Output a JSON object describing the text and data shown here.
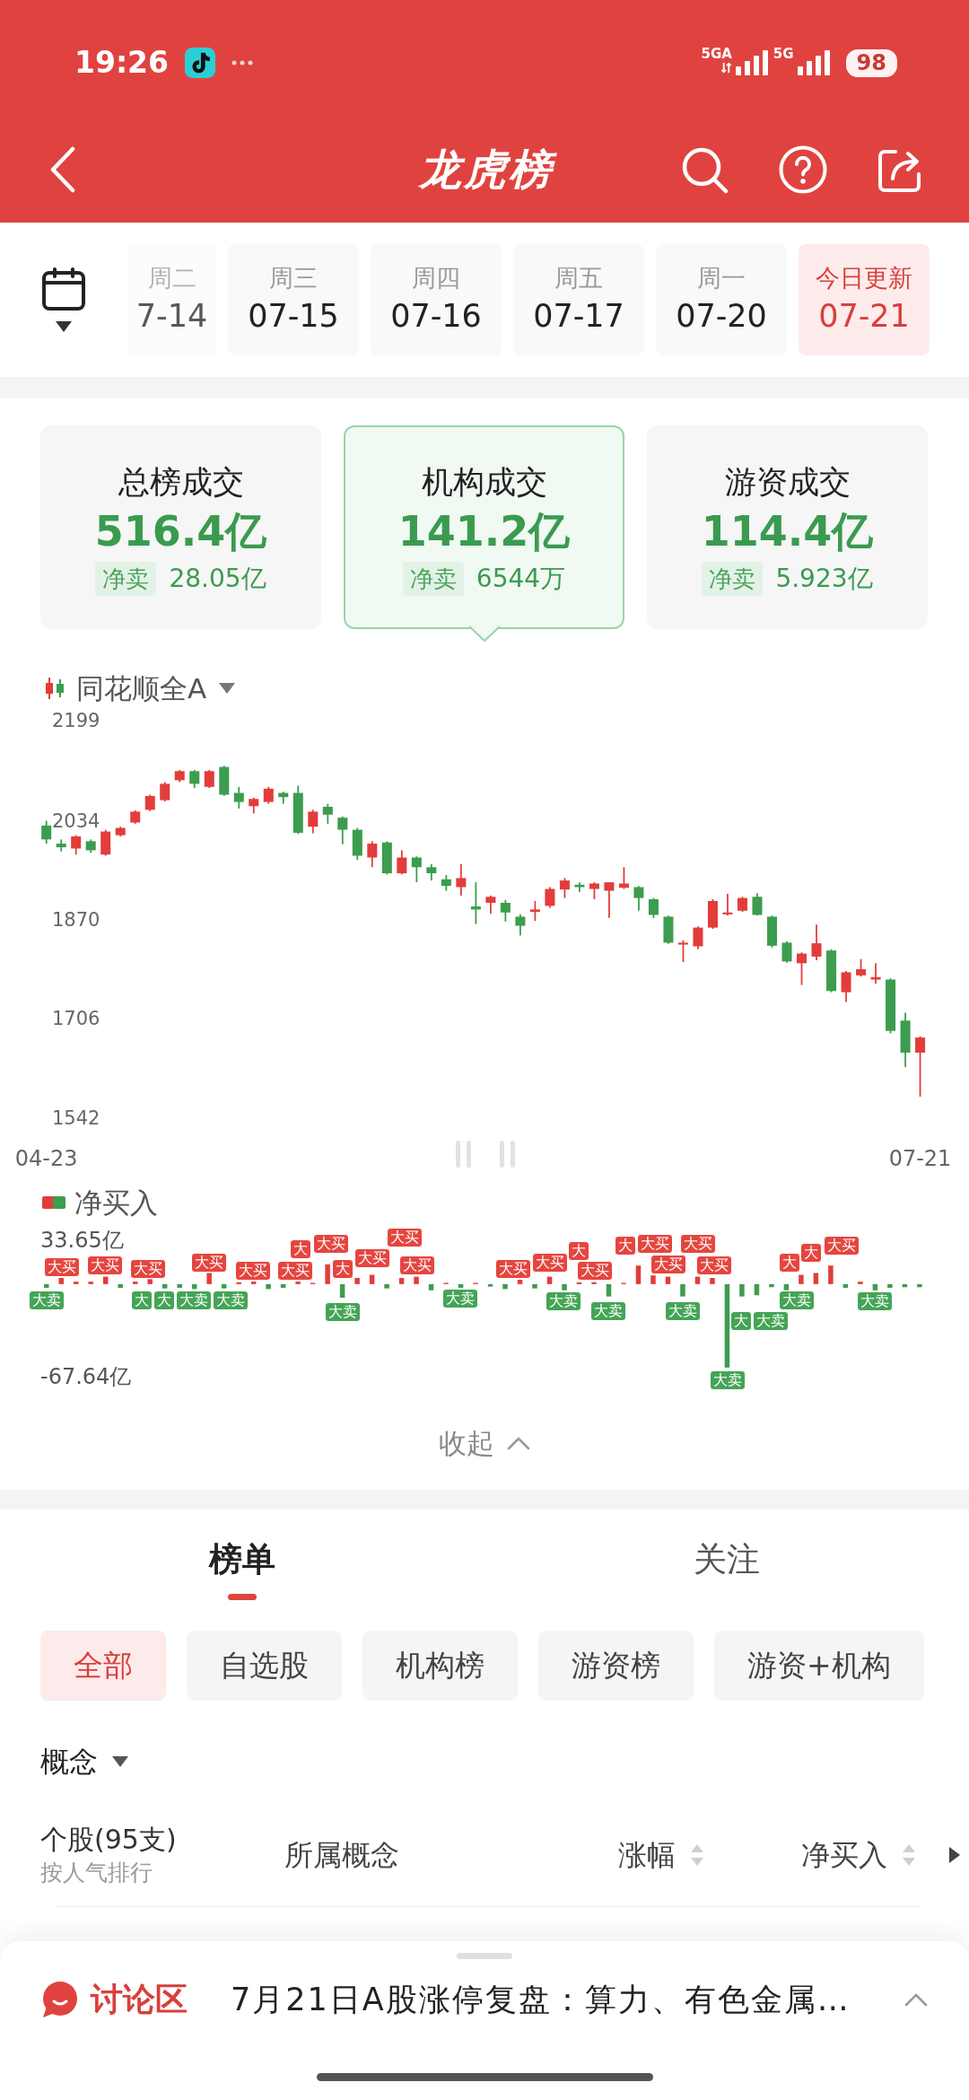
{
  "status_bar": {
    "time": "19:26",
    "networks": [
      {
        "label": "5GA",
        "activity": true
      },
      {
        "label": "5G",
        "activity": false
      }
    ],
    "battery": "98"
  },
  "header": {
    "title": "龙虎榜"
  },
  "date_tabs": [
    {
      "weekday": "周二",
      "date": "7-14",
      "selected": false
    },
    {
      "weekday": "周三",
      "date": "07-15",
      "selected": false
    },
    {
      "weekday": "周四",
      "date": "07-16",
      "selected": false
    },
    {
      "weekday": "周五",
      "date": "07-17",
      "selected": false
    },
    {
      "weekday": "周一",
      "date": "07-20",
      "selected": false
    },
    {
      "weekday": "今日更新",
      "date": "07-21",
      "selected": true
    }
  ],
  "summary_cards": [
    {
      "title": "总榜成交",
      "amount": "516.4亿",
      "tag": "净卖",
      "net": "28.05亿",
      "selected": false
    },
    {
      "title": "机构成交",
      "amount": "141.2亿",
      "tag": "净卖",
      "net": "6544万",
      "selected": true
    },
    {
      "title": "游资成交",
      "amount": "114.4亿",
      "tag": "净卖",
      "net": "5.923亿",
      "selected": false
    }
  ],
  "index_chart": {
    "index_name": "同花顺全A",
    "chart_data": {
      "type": "candlestick",
      "categories": [
        "04-23",
        null,
        null,
        null,
        null,
        null,
        null,
        null,
        null,
        null,
        null,
        null,
        null,
        null,
        null,
        null,
        null,
        null,
        null,
        null,
        null,
        null,
        null,
        null,
        null,
        null,
        null,
        null,
        null,
        null,
        null,
        null,
        null,
        null,
        null,
        null,
        null,
        null,
        null,
        null,
        null,
        null,
        null,
        null,
        null,
        null,
        null,
        null,
        null,
        null,
        null,
        null,
        null,
        null,
        null,
        null,
        null,
        null,
        null,
        "07-21"
      ],
      "ohlc": [
        [
          2026,
          2034,
          1996,
          2003
        ],
        [
          1996,
          2003,
          1983,
          1990
        ],
        [
          1988,
          2010,
          1978,
          2008
        ],
        [
          2000,
          2003,
          1981,
          1985
        ],
        [
          1978,
          2019,
          1976,
          2016
        ],
        [
          2010,
          2024,
          2008,
          2022
        ],
        [
          2031,
          2051,
          2029,
          2049
        ],
        [
          2052,
          2077,
          2050,
          2075
        ],
        [
          2068,
          2098,
          2066,
          2095
        ],
        [
          2101,
          2118,
          2098,
          2116
        ],
        [
          2116,
          2118,
          2088,
          2095
        ],
        [
          2090,
          2118,
          2088,
          2116
        ],
        [
          2123,
          2125,
          2075,
          2077
        ],
        [
          2080,
          2090,
          2054,
          2065
        ],
        [
          2058,
          2072,
          2046,
          2070
        ],
        [
          2065,
          2090,
          2062,
          2087
        ],
        [
          2080,
          2082,
          2062,
          2073
        ],
        [
          2080,
          2092,
          2012,
          2014
        ],
        [
          2024,
          2052,
          2013,
          2049
        ],
        [
          2057,
          2062,
          2029,
          2044
        ],
        [
          2039,
          2041,
          1995,
          2019
        ],
        [
          2019,
          2022,
          1969,
          1976
        ],
        [
          1973,
          2000,
          1957,
          1996
        ],
        [
          1998,
          2000,
          1945,
          1947
        ],
        [
          1947,
          1985,
          1945,
          1973
        ],
        [
          1973,
          1975,
          1932,
          1957
        ],
        [
          1957,
          1962,
          1935,
          1947
        ],
        [
          1937,
          1944,
          1918,
          1926
        ],
        [
          1924,
          1962,
          1910,
          1939
        ],
        [
          1892,
          1932,
          1863,
          1887
        ],
        [
          1898,
          1910,
          1880,
          1908
        ],
        [
          1898,
          1903,
          1867,
          1882
        ],
        [
          1875,
          1879,
          1844,
          1860
        ],
        [
          1883,
          1901,
          1868,
          1887
        ],
        [
          1893,
          1924,
          1890,
          1921
        ],
        [
          1920,
          1939,
          1906,
          1935
        ],
        [
          1928,
          1932,
          1916,
          1924
        ],
        [
          1921,
          1932,
          1904,
          1930
        ],
        [
          1918,
          1932,
          1873,
          1932
        ],
        [
          1923,
          1957,
          1921,
          1930
        ],
        [
          1924,
          1926,
          1885,
          1906
        ],
        [
          1904,
          1906,
          1873,
          1878
        ],
        [
          1875,
          1877,
          1830,
          1832
        ],
        [
          1829,
          1836,
          1800,
          1832
        ],
        [
          1826,
          1859,
          1821,
          1857
        ],
        [
          1857,
          1904,
          1855,
          1901
        ],
        [
          1879,
          1913,
          1877,
          1882
        ],
        [
          1885,
          1908,
          1883,
          1906
        ],
        [
          1908,
          1914,
          1877,
          1878
        ],
        [
          1875,
          1877,
          1824,
          1827
        ],
        [
          1832,
          1834,
          1799,
          1801
        ],
        [
          1798,
          1816,
          1762,
          1814
        ],
        [
          1809,
          1862,
          1803,
          1831
        ],
        [
          1819,
          1821,
          1750,
          1752
        ],
        [
          1750,
          1785,
          1734,
          1783
        ],
        [
          1778,
          1805,
          1776,
          1788
        ],
        [
          1771,
          1798,
          1764,
          1775
        ],
        [
          1771,
          1773,
          1682,
          1686
        ],
        [
          1703,
          1716,
          1626,
          1650
        ],
        [
          1650,
          1677,
          1577,
          1675
        ]
      ],
      "ylim": [
        1542,
        2199
      ],
      "yticks": [
        2199,
        2034,
        1870,
        1706,
        1542
      ]
    }
  },
  "net_buy_chart": {
    "legend": "净买入",
    "y_labels": [
      "33.65亿",
      "-67.64亿"
    ],
    "markers": [
      {
        "label": "大卖",
        "kind": "sell"
      },
      {
        "label": "大买",
        "kind": "buy"
      },
      {
        "label": "大买",
        "kind": "buy"
      },
      {
        "label": "大",
        "kind": "sell"
      },
      {
        "label": "大买",
        "kind": "buy"
      },
      {
        "label": "大",
        "kind": "sell"
      },
      {
        "label": "大卖",
        "kind": "sell"
      },
      {
        "label": "大买",
        "kind": "buy"
      },
      {
        "label": "大卖",
        "kind": "sell"
      },
      {
        "label": "大买",
        "kind": "buy"
      },
      {
        "label": "大买",
        "kind": "buy"
      },
      {
        "label": "大",
        "kind": "buy"
      },
      {
        "label": "大买",
        "kind": "buy"
      },
      {
        "label": "大卖",
        "kind": "sell"
      },
      {
        "label": "大",
        "kind": "buy"
      },
      {
        "label": "大买",
        "kind": "buy"
      },
      {
        "label": "大买",
        "kind": "buy"
      },
      {
        "label": "大买",
        "kind": "buy"
      },
      {
        "label": "大卖",
        "kind": "sell"
      },
      {
        "label": "大买",
        "kind": "buy"
      },
      {
        "label": "大买",
        "kind": "buy"
      },
      {
        "label": "大卖",
        "kind": "sell"
      },
      {
        "label": "大",
        "kind": "buy"
      },
      {
        "label": "大买",
        "kind": "buy"
      },
      {
        "label": "大卖",
        "kind": "sell"
      },
      {
        "label": "大",
        "kind": "buy"
      },
      {
        "label": "大买",
        "kind": "buy"
      },
      {
        "label": "大买",
        "kind": "buy"
      },
      {
        "label": "大卖",
        "kind": "sell"
      },
      {
        "label": "大买",
        "kind": "buy"
      },
      {
        "label": "大买",
        "kind": "buy"
      },
      {
        "label": "大卖",
        "kind": "sell"
      },
      {
        "label": "大",
        "kind": "sell"
      },
      {
        "label": "大卖",
        "kind": "sell"
      },
      {
        "label": "大",
        "kind": "buy"
      },
      {
        "label": "大卖",
        "kind": "sell"
      },
      {
        "label": "大",
        "kind": "buy"
      },
      {
        "label": "大买",
        "kind": "buy"
      },
      {
        "label": "大卖",
        "kind": "sell"
      }
    ]
  },
  "collapse": {
    "label": "收起"
  },
  "main_tabs": [
    {
      "label": "榜单",
      "selected": true
    },
    {
      "label": "关注",
      "selected": false
    }
  ],
  "filters": [
    {
      "label": "全部",
      "selected": true
    },
    {
      "label": "自选股",
      "selected": false
    },
    {
      "label": "机构榜",
      "selected": false
    },
    {
      "label": "游资榜",
      "selected": false
    },
    {
      "label": "游资+机构",
      "selected": false
    }
  ],
  "category_filter": {
    "label": "概念"
  },
  "table": {
    "columns": [
      {
        "label": "个股(95支)",
        "note": "按人气排行",
        "sortable": false
      },
      {
        "label": "所属概念",
        "sortable": false
      },
      {
        "label": "涨幅",
        "sortable": true
      },
      {
        "label": "净买入",
        "sortable": true
      }
    ]
  },
  "discussion": {
    "label": "讨论区",
    "headline": "7月21日A股涨停复盘：算力、有色金属…"
  }
}
